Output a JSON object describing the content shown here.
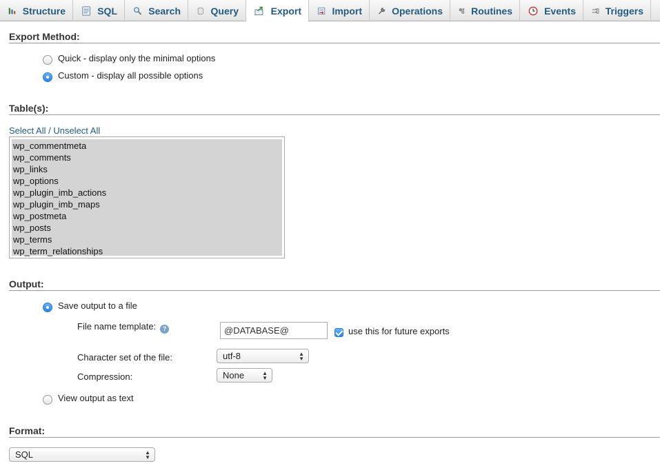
{
  "tabs": [
    {
      "label": "Structure",
      "icon": "structure-icon"
    },
    {
      "label": "SQL",
      "icon": "sql-icon"
    },
    {
      "label": "Search",
      "icon": "search-icon"
    },
    {
      "label": "Query",
      "icon": "query-icon"
    },
    {
      "label": "Export",
      "icon": "export-icon"
    },
    {
      "label": "Import",
      "icon": "import-icon"
    },
    {
      "label": "Operations",
      "icon": "wrench-icon"
    },
    {
      "label": "Routines",
      "icon": "routines-icon"
    },
    {
      "label": "Events",
      "icon": "clock-icon"
    },
    {
      "label": "Triggers",
      "icon": "triggers-icon"
    }
  ],
  "active_tab": "Export",
  "export_method": {
    "title": "Export Method:",
    "quick_label": "Quick - display only the minimal options",
    "custom_label": "Custom - display all possible options",
    "selected": "custom"
  },
  "tables": {
    "title": "Table(s):",
    "select_all": "Select All",
    "separator": " / ",
    "unselect_all": "Unselect All",
    "items": [
      "wp_commentmeta",
      "wp_comments",
      "wp_links",
      "wp_options",
      "wp_plugin_imb_actions",
      "wp_plugin_imb_maps",
      "wp_postmeta",
      "wp_posts",
      "wp_terms",
      "wp_term_relationships"
    ]
  },
  "output": {
    "title": "Output:",
    "save_to_file_label": "Save output to a file",
    "file_name_template_label": "File name template:",
    "file_name_template_value": "@DATABASE@",
    "use_future_label": "use this for future exports",
    "use_future_checked": true,
    "charset_label": "Character set of the file:",
    "charset_value": "utf-8",
    "compression_label": "Compression:",
    "compression_value": "None",
    "view_as_text_label": "View output as text",
    "selected": "save"
  },
  "format": {
    "title": "Format:",
    "value": "SQL"
  },
  "colors": {
    "accent": "#235a81",
    "radio_selected": "#2a83e0"
  }
}
